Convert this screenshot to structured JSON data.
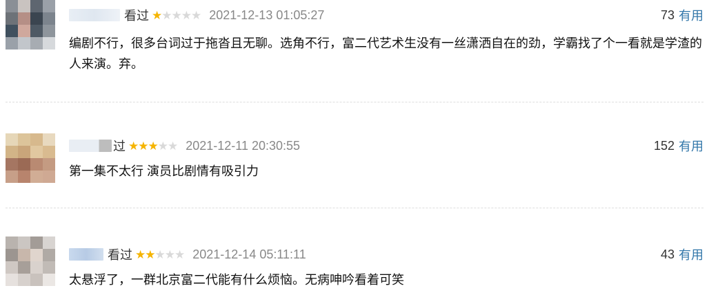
{
  "reviews": [
    {
      "seen": "看过",
      "rating": 1,
      "time": "2021-12-13 01:05:27",
      "votes": "73",
      "useful": "有用",
      "content": "编剧不行，很多台词过于拖沓且无聊。选角不行，富二代艺术生没有一丝潇洒自在的劲，学霸找了个一看就是学渣的人来演。弃。"
    },
    {
      "seen": "过",
      "rating": 3,
      "time": "2021-12-11 20:30:55",
      "votes": "152",
      "useful": "有用",
      "content": "第一集不太行 演员比剧情有吸引力"
    },
    {
      "seen": "看过",
      "rating": 2,
      "time": "2021-12-14 05:11:11",
      "votes": "43",
      "useful": "有用",
      "content": "太悬浮了，一群北京富二代能有什么烦恼。无病呻吟看着可笑"
    }
  ],
  "colors": {
    "star_on": "#f5b400",
    "star_off": "#d9d9d9",
    "link": "#3377aa",
    "time": "#888888"
  },
  "icons": {
    "star": "star-icon"
  }
}
